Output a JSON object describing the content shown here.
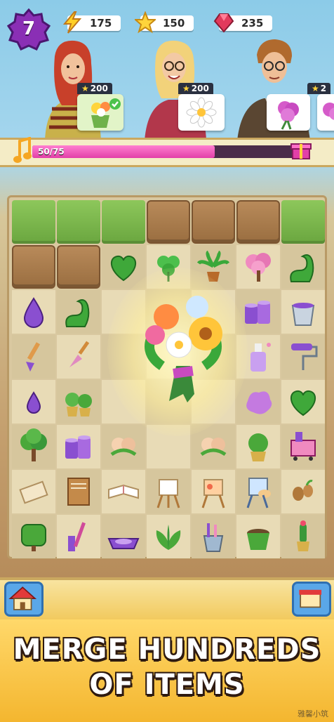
{
  "hud": {
    "level": "7",
    "energy": "175",
    "stars": "150",
    "gems": "235",
    "colors": {
      "level_badge": "#8a2fb5",
      "energy": "#ffcf26",
      "gem": "#e23a5c"
    }
  },
  "customers": [
    {
      "name": "redhead-woman",
      "order_stars": "200",
      "order_item": "flower-pot-bouquet",
      "completed": true
    },
    {
      "name": "blonde-woman",
      "order_stars": "200",
      "order_item": "white-daisy"
    },
    {
      "name": "man-with-glasses",
      "order_item": "pink-hydrangea"
    },
    {
      "name": "partial-customer",
      "order_stars": "2",
      "order_item": "pink-hydrangea"
    }
  ],
  "progress": {
    "text": "50/75",
    "fraction": 0.667,
    "icon": "music-note-icon",
    "reward": "gift-box-icon"
  },
  "board": {
    "rows": [
      [
        "grass",
        "grass",
        "grass",
        "dirt",
        "dirt",
        "dirt",
        "grass"
      ],
      [
        "dirt",
        "dirt",
        "hedge-heart",
        "clover",
        "potted-palm",
        "pink-tree",
        "hedge-swan"
      ],
      [
        "water-drop",
        "hedge-swan",
        "",
        "",
        "",
        "paint-cans",
        "paint-bucket"
      ],
      [
        "paintbrush",
        "trowel",
        "",
        "",
        "",
        "spray-bottle",
        "paint-roller"
      ],
      [
        "water-drop-small",
        "shrub-pots",
        "",
        "",
        "",
        "paint-splash",
        "hedge-heart"
      ],
      [
        "tree",
        "paint-cans",
        "rose-bud",
        "",
        "rose-bud",
        "potted-shrub",
        "paint-cart"
      ],
      [
        "scroll",
        "sketchbook",
        "open-book",
        "easel",
        "easel-painting",
        "easel-palette",
        "seeds"
      ],
      [
        "bush",
        "brush-set",
        "paint-tray",
        "leafy-plant",
        "tool-cup",
        "plant-pot",
        "cactus"
      ]
    ],
    "center_item": "bouquet"
  },
  "bottom": {
    "home": "home-icon"
  },
  "banner": {
    "line1": "MERGE HUNDREDS",
    "line2": "OF ITEMS"
  },
  "watermark": "雅馨小筑"
}
